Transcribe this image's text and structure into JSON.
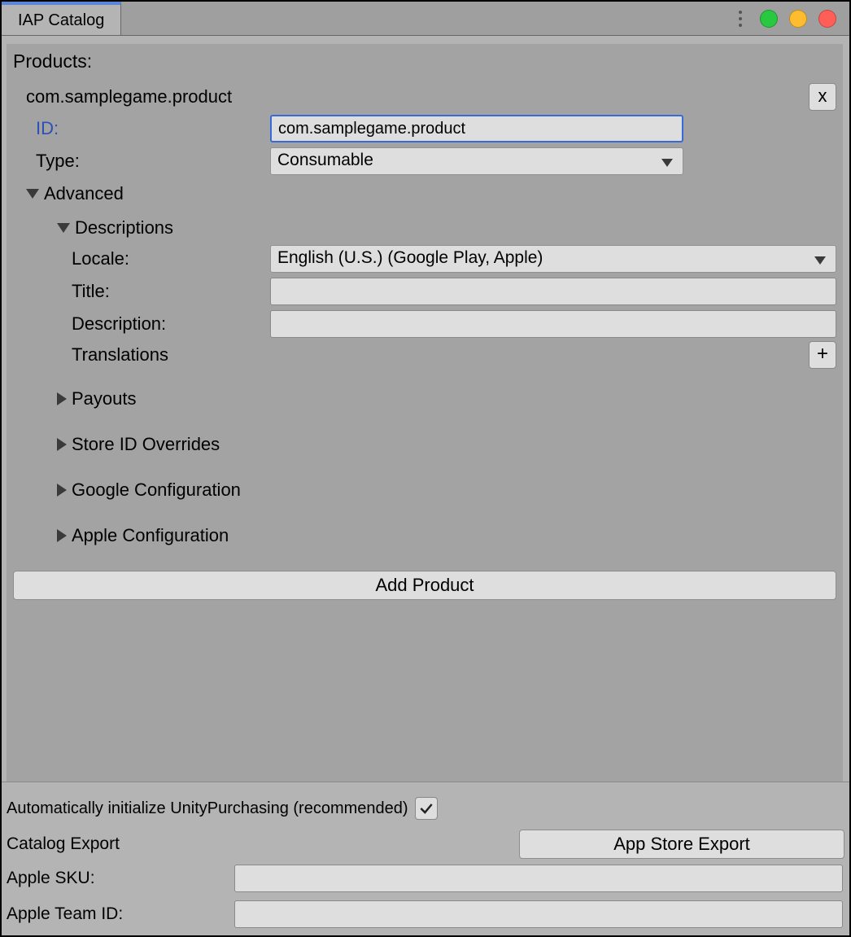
{
  "tab_title": "IAP Catalog",
  "products_label": "Products:",
  "product": {
    "header_id": "com.samplegame.product",
    "remove_label": "x",
    "id_label": "ID:",
    "id_value": "com.samplegame.product",
    "type_label": "Type:",
    "type_value": "Consumable",
    "advanced_label": "Advanced",
    "descriptions_label": "Descriptions",
    "locale_label": "Locale:",
    "locale_value": "English (U.S.) (Google Play, Apple)",
    "title_label": "Title:",
    "title_value": "",
    "description_label": "Description:",
    "description_value": "",
    "translations_label": "Translations",
    "translations_add": "+",
    "payouts_label": "Payouts",
    "store_overrides_label": "Store ID Overrides",
    "google_config_label": "Google Configuration",
    "apple_config_label": "Apple Configuration"
  },
  "add_product_label": "Add Product",
  "bottom": {
    "auto_init_label": "Automatically initialize UnityPurchasing (recommended)",
    "auto_init_checked": true,
    "catalog_export_label": "Catalog Export",
    "app_store_export_label": "App Store Export",
    "apple_sku_label": "Apple SKU:",
    "apple_sku_value": "",
    "apple_team_label": "Apple Team ID:",
    "apple_team_value": ""
  }
}
